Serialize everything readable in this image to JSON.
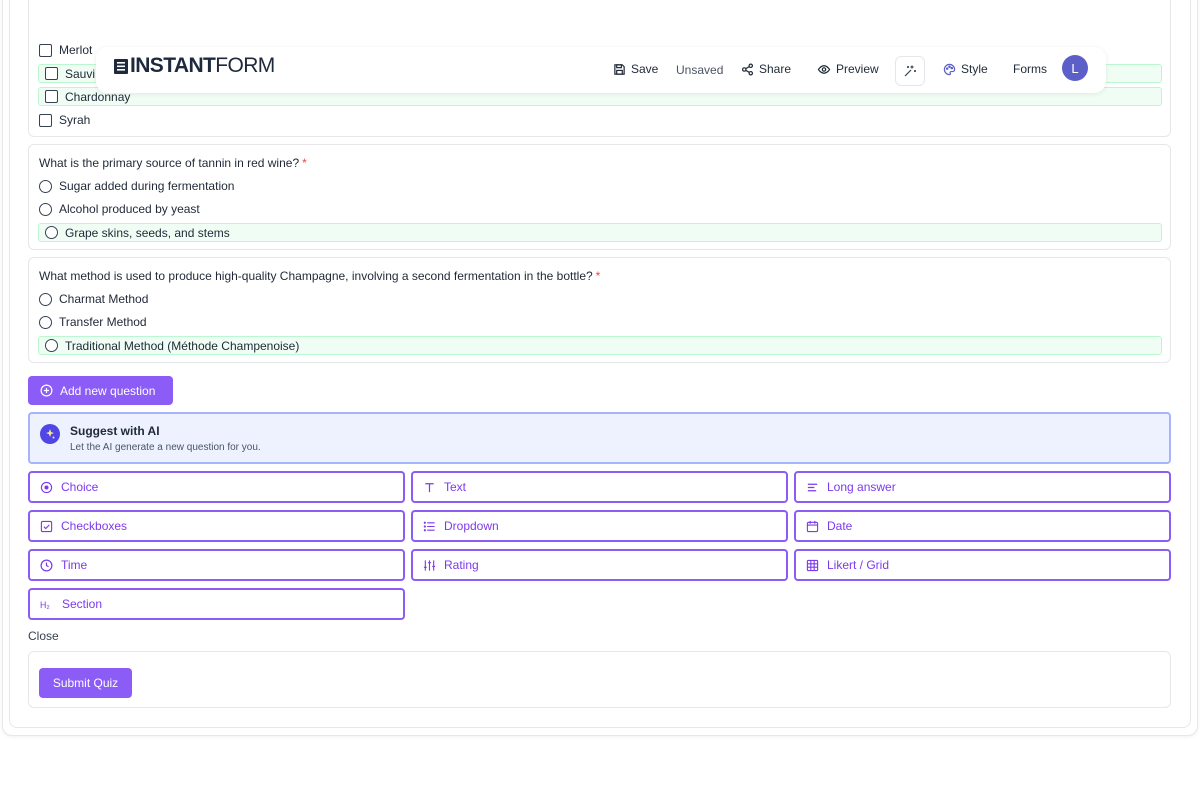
{
  "header": {
    "brand_bold": "INSTANT",
    "brand_light": "FORM",
    "save_label": "Save",
    "status": "Unsaved",
    "share_label": "Share",
    "preview_label": "Preview",
    "style_label": "Style",
    "forms_label": "Forms",
    "avatar_initial": "L"
  },
  "question1": {
    "options": [
      "Merlot",
      "Sauvi",
      "Chardonnay",
      "Syrah"
    ]
  },
  "question2": {
    "title": "What is the primary source of tannin in red wine?",
    "required_mark": "*",
    "options": [
      "Sugar added during fermentation",
      "Alcohol produced by yeast",
      "Grape skins, seeds, and stems"
    ]
  },
  "question3": {
    "title": "What method is used to produce high-quality Champagne, involving a second fermentation in the bottle?",
    "required_mark": "*",
    "options": [
      "Charmat Method",
      "Transfer Method",
      "Traditional Method (Méthode Champenoise)"
    ]
  },
  "add_question_label": "Add new question",
  "ai_suggest": {
    "title": "Suggest with AI",
    "subtitle": "Let the AI generate a new question for you."
  },
  "question_types": {
    "choice": "Choice",
    "text": "Text",
    "long_answer": "Long answer",
    "checkboxes": "Checkboxes",
    "dropdown": "Dropdown",
    "date": "Date",
    "time": "Time",
    "rating": "Rating",
    "likert": "Likert / Grid",
    "section": "Section"
  },
  "close_label": "Close",
  "submit_label": "Submit Quiz",
  "colors": {
    "accent": "#8b5cf6",
    "correct_bg": "#f0fdf4",
    "avatar": "#5b5fc7",
    "required": "#ef4444"
  }
}
